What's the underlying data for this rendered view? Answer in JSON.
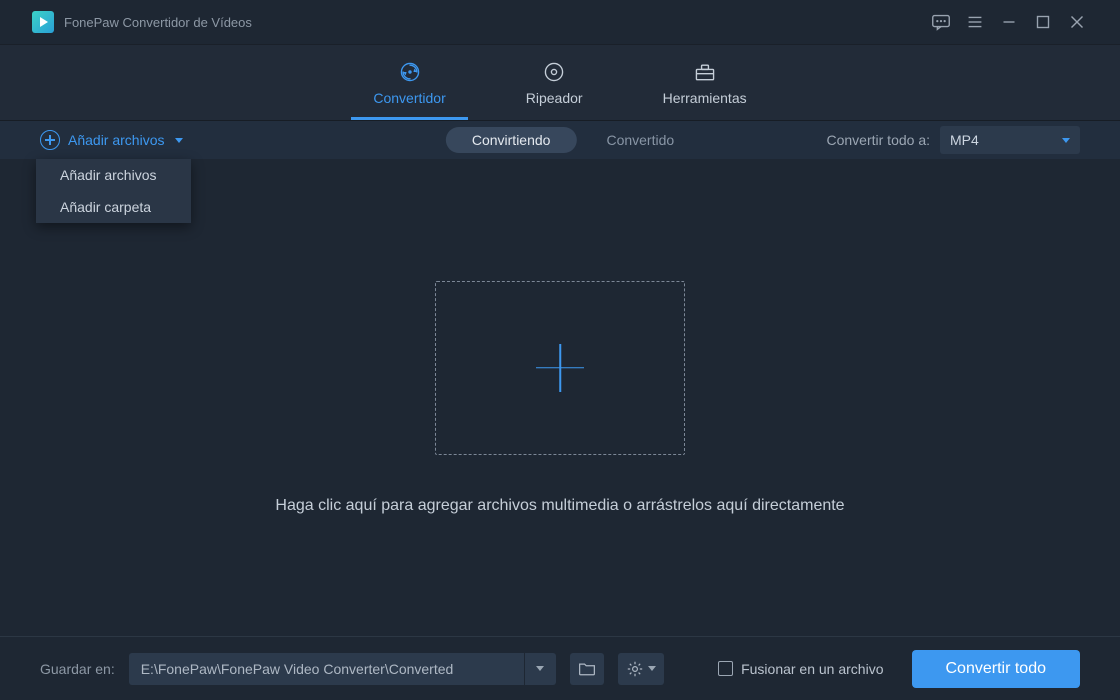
{
  "titlebar": {
    "app_name": "FonePaw Convertidor de Vídeos"
  },
  "main_tabs": [
    {
      "id": "convertidor",
      "label": "Convertidor",
      "active": true
    },
    {
      "id": "ripeador",
      "label": "Ripeador",
      "active": false
    },
    {
      "id": "herramientas",
      "label": "Herramientas",
      "active": false
    }
  ],
  "actionbar": {
    "add_label": "Añadir archivos",
    "dropdown_items": [
      "Añadir archivos",
      "Añadir carpeta"
    ],
    "seg_active": "Convirtiendo",
    "seg_inactive": "Convertido",
    "convert_all_label": "Convertir todo a:",
    "format_selected": "MP4"
  },
  "content": {
    "hint": "Haga clic aquí para agregar archivos multimedia o arrástrelos aquí directamente"
  },
  "bottombar": {
    "save_label": "Guardar en:",
    "save_path": "E:\\FonePaw\\FonePaw Video Converter\\Converted",
    "merge_label": "Fusionar en un archivo",
    "convert_button": "Convertir todo"
  }
}
